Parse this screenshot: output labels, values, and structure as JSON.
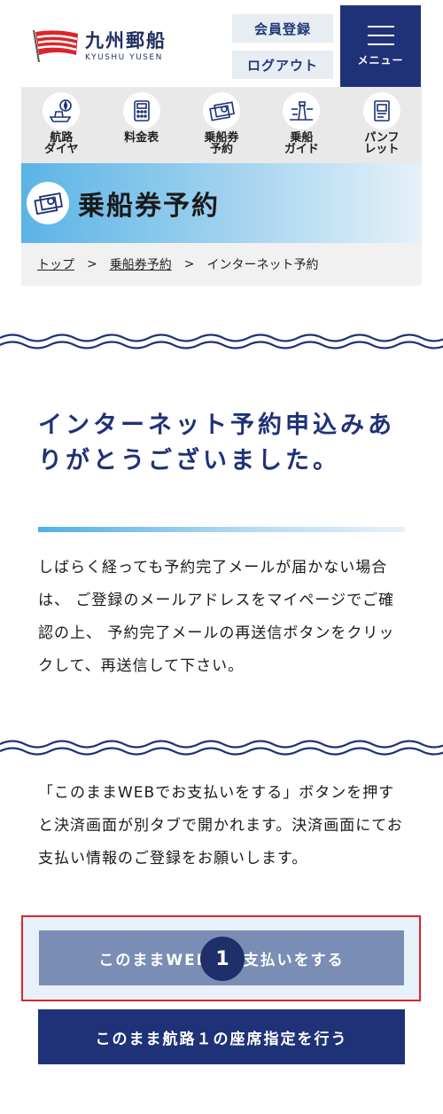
{
  "header": {
    "logo_name": "九州郵船",
    "logo_sub": "KYUSHU YUSEN",
    "register_label": "会員登録",
    "logout_label": "ログアウト",
    "menu_label": "メニュー"
  },
  "nav": [
    {
      "label": "航路\nダイヤ",
      "icon": "compass-ship-icon"
    },
    {
      "label": "料金表",
      "icon": "calculator-icon"
    },
    {
      "label": "乗船券\n予約",
      "icon": "ticket-icon"
    },
    {
      "label": "乗船\nガイド",
      "icon": "lighthouse-icon"
    },
    {
      "label": "パンフ\nレット",
      "icon": "brochure-icon"
    }
  ],
  "banner": {
    "title": "乗船券予約",
    "icon": "ticket-icon"
  },
  "breadcrumb": {
    "top": "トップ",
    "reservation": "乗船券予約",
    "current": "インターネット予約",
    "separator": ">"
  },
  "main": {
    "heading": "インターネット予約申込みありがとうございました。",
    "message": "しばらく経っても予約完了メールが届かない場合は、 ご登録のメールアドレスをマイページでご確認の上、 予約完了メールの再送信ボタンをクリックして、再送信して下さい。",
    "payment_note": "「このままWEBでお支払いをする」ボタンを押すと決済画面が別タブで開かれます。決済画面にてお支払い情報のご登録をお願いします。",
    "pay_button": "このままWEBでお支払いをする",
    "badge": "1",
    "seat_button": "このまま航路１の座席指定を行う"
  },
  "colors": {
    "navy": "#1f3278",
    "accent_red": "#d9262c",
    "sky": "#5ab4e6"
  }
}
